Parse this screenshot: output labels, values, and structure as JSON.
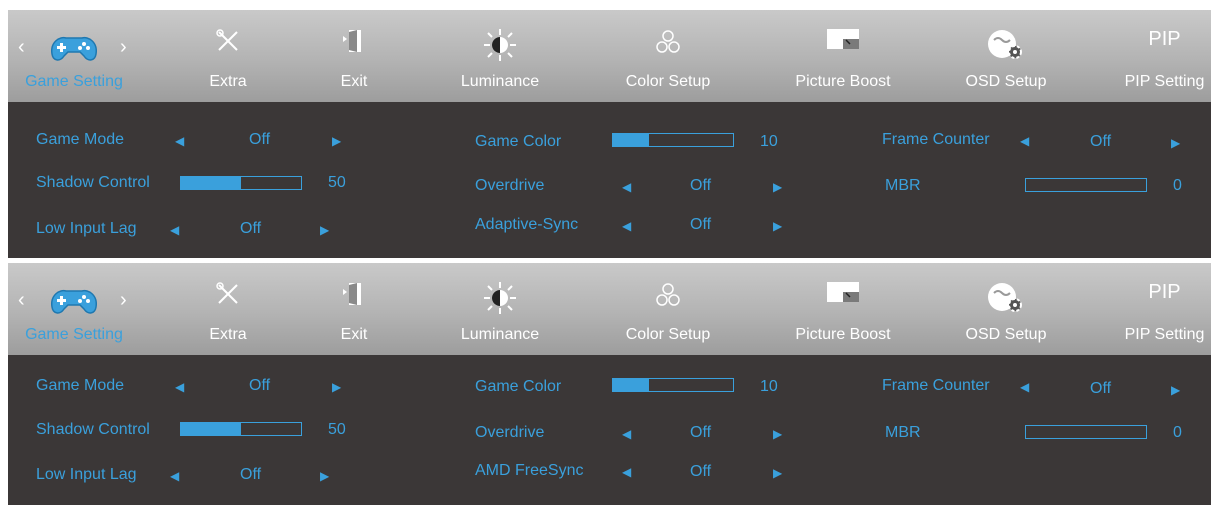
{
  "panels": [
    {
      "tabs": {
        "game": "Game Setting",
        "extra": "Extra",
        "exit": "Exit",
        "luminance": "Luminance",
        "color_setup": "Color Setup",
        "picture_boost": "Picture Boost",
        "osd_setup": "OSD Setup",
        "pip_short": "PIP",
        "pip_setting": "PIP Setting"
      },
      "items": {
        "game_mode": {
          "label": "Game Mode",
          "value": "Off"
        },
        "shadow_control": {
          "label": "Shadow Control",
          "value": "50"
        },
        "low_input_lag": {
          "label": "Low Input Lag",
          "value": "Off"
        },
        "game_color": {
          "label": "Game Color",
          "value": "10"
        },
        "overdrive": {
          "label": "Overdrive",
          "value": "Off"
        },
        "sync": {
          "label": "Adaptive-Sync",
          "value": "Off"
        },
        "frame_counter": {
          "label": "Frame Counter",
          "value": "Off"
        },
        "mbr": {
          "label": "MBR",
          "value": "0"
        }
      },
      "levels": {
        "shadow_control": 0.5,
        "game_color": 0.3,
        "mbr": 0.0
      }
    },
    {
      "tabs": {
        "game": "Game Setting",
        "extra": "Extra",
        "exit": "Exit",
        "luminance": "Luminance",
        "color_setup": "Color Setup",
        "picture_boost": "Picture Boost",
        "osd_setup": "OSD Setup",
        "pip_short": "PIP",
        "pip_setting": "PIP Setting"
      },
      "items": {
        "game_mode": {
          "label": "Game Mode",
          "value": "Off"
        },
        "shadow_control": {
          "label": "Shadow Control",
          "value": "50"
        },
        "low_input_lag": {
          "label": "Low Input Lag",
          "value": "Off"
        },
        "game_color": {
          "label": "Game Color",
          "value": "10"
        },
        "overdrive": {
          "label": "Overdrive",
          "value": "Off"
        },
        "sync": {
          "label": "AMD FreeSync",
          "value": "Off"
        },
        "frame_counter": {
          "label": "Frame Counter",
          "value": "Off"
        },
        "mbr": {
          "label": "MBR",
          "value": "0"
        }
      },
      "levels": {
        "shadow_control": 0.5,
        "game_color": 0.3,
        "mbr": 0.0
      }
    }
  ],
  "icons": [
    "gamepad-icon",
    "tools-icon",
    "exit-door-icon",
    "brightness-icon",
    "color-balls-icon",
    "picture-boost-icon",
    "osd-globe-gear-icon"
  ],
  "colors": {
    "accent": "#3aa0dc",
    "panel_bg": "#3b3737",
    "tabbar_light": "#c9c9c9",
    "tabbar_dark": "#9d9d9d",
    "text_white": "#ffffff"
  }
}
